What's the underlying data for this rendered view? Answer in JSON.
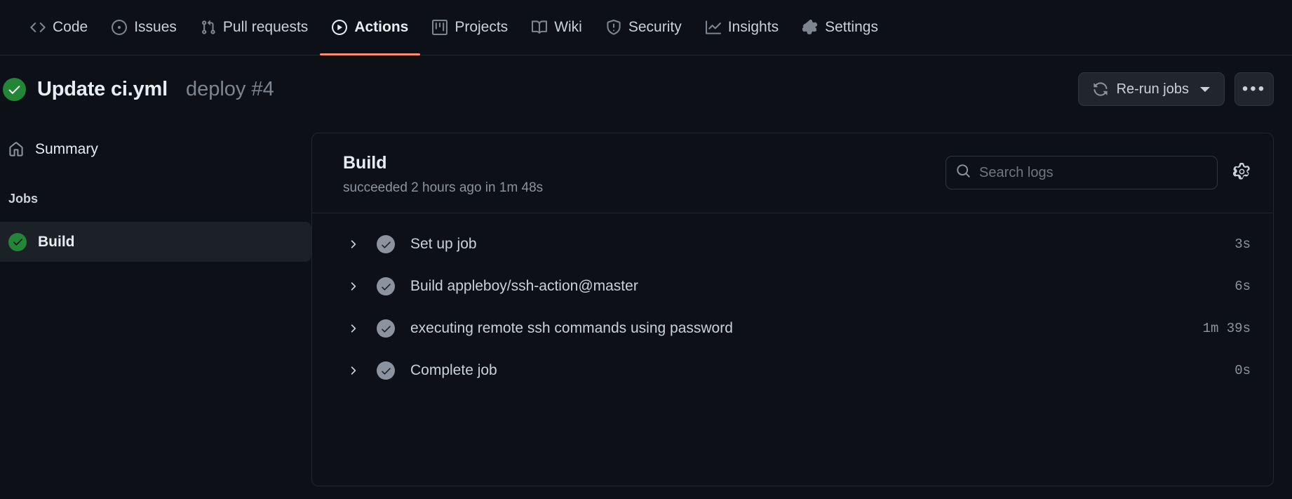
{
  "repo_nav": {
    "accent_color": "#fd8c73",
    "items": [
      {
        "label": "Code",
        "icon": "code-icon",
        "active": false
      },
      {
        "label": "Issues",
        "icon": "issue-opened-icon",
        "active": false
      },
      {
        "label": "Pull requests",
        "icon": "git-pull-request-icon",
        "active": false
      },
      {
        "label": "Actions",
        "icon": "play-icon",
        "active": true
      },
      {
        "label": "Projects",
        "icon": "project-icon",
        "active": false
      },
      {
        "label": "Wiki",
        "icon": "book-icon",
        "active": false
      },
      {
        "label": "Security",
        "icon": "shield-icon",
        "active": false
      },
      {
        "label": "Insights",
        "icon": "graph-icon",
        "active": false
      },
      {
        "label": "Settings",
        "icon": "gear-icon",
        "active": false
      }
    ]
  },
  "page_header": {
    "status_icon": "check-circle-fill-icon",
    "status_color": "#238636",
    "title": "Update ci.yml",
    "subtitle": "deploy #4",
    "rerun_button": {
      "label": "Re-run jobs",
      "icon": "sync-icon"
    },
    "kebab_button": {
      "label": "•••",
      "icon": "kebab-horizontal-icon"
    }
  },
  "sidebar": {
    "summary": {
      "label": "Summary",
      "icon": "home-icon"
    },
    "jobs_heading": "Jobs",
    "jobs": [
      {
        "name": "Build",
        "status": "success",
        "selected": true
      }
    ]
  },
  "job_panel": {
    "title": "Build",
    "status_text": "succeeded 2 hours ago in 1m 48s",
    "search": {
      "placeholder": "Search logs",
      "value": "",
      "icon": "search-icon"
    },
    "settings_icon": "gear-icon",
    "steps": [
      {
        "name": "Set up job",
        "duration": "3s",
        "status": "success"
      },
      {
        "name": "Build appleboy/ssh-action@master",
        "duration": "6s",
        "status": "success"
      },
      {
        "name": "executing remote ssh commands using password",
        "duration": "1m 39s",
        "status": "success"
      },
      {
        "name": "Complete job",
        "duration": "0s",
        "status": "success"
      }
    ]
  }
}
